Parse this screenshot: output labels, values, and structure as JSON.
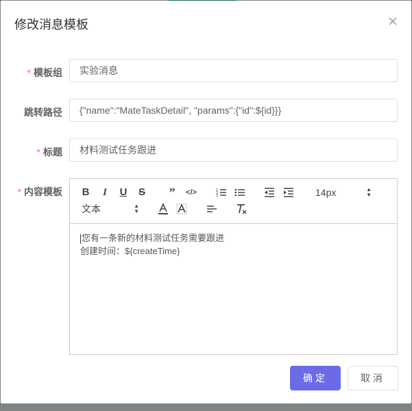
{
  "dialog": {
    "title": "修改消息模板",
    "close_icon": "close-icon"
  },
  "form": {
    "group": {
      "label": "模板组",
      "required": true,
      "value": "实验消息"
    },
    "route": {
      "label": "跳转路径",
      "required": false,
      "value": "{\"name\":\"MateTaskDetail\", \"params\":{\"id\":${id}}}"
    },
    "title": {
      "label": "标题",
      "required": true,
      "value": "材料测试任务跟进"
    },
    "content": {
      "label": "内容模板",
      "required": true
    }
  },
  "editor": {
    "font_size": "14px",
    "block_type": "文本",
    "tools": [
      "bold-icon",
      "italic-icon",
      "underline-icon",
      "strikethrough-icon",
      "quote-icon",
      "code-icon",
      "ordered-list-icon",
      "bullet-list-icon",
      "outdent-icon",
      "indent-icon",
      "font-color-icon",
      "background-color-icon",
      "align-left-icon",
      "clear-format-icon"
    ],
    "lines": [
      "您有一条新的材料测试任务需要跟进",
      "创建时间：${createTime}"
    ]
  },
  "footer": {
    "confirm_label": "确定",
    "cancel_label": "取消"
  },
  "colors": {
    "primary": "#6b6be8",
    "required": "#f56c6c"
  }
}
